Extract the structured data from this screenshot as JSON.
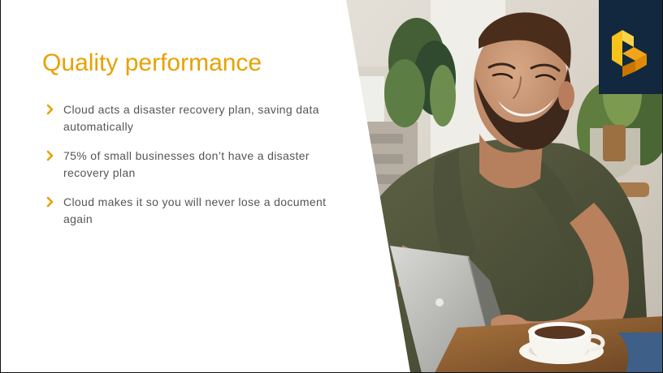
{
  "slide": {
    "title": "Quality performance",
    "bullets": [
      {
        "text": "Cloud acts a disaster recovery plan, saving data automatically"
      },
      {
        "text": "75% of small businesses don’t have a disaster recovery plan"
      },
      {
        "text": "Cloud makes it so you will never lose a document again"
      }
    ],
    "photo": {
      "description_icon": "man-with-laptop-photo"
    },
    "logo": {
      "icon": "b-logo"
    }
  },
  "colors": {
    "accent": "#e8a100",
    "text": "#555555",
    "logo_bg": "#12283e",
    "logo_light": "#f7c21b",
    "logo_dark": "#c77600"
  }
}
